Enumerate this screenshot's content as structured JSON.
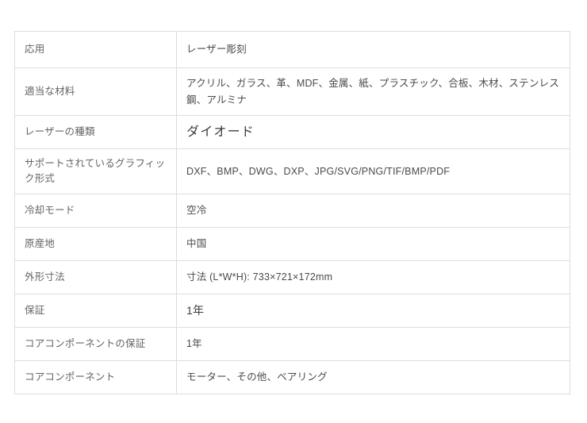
{
  "document": {
    "type": "specification-table",
    "background_color": "#ffffff",
    "border_color": "#dddddd",
    "label_color": "#646464",
    "value_color": "#4a4a4a"
  },
  "table": {
    "rows": [
      {
        "label": "応用",
        "value": "レーザー彫刻",
        "height_class": "h-first",
        "value_size": "normal"
      },
      {
        "label": "適当な材料",
        "value": "アクリル、ガラス、革、MDF、金属、紙、プラスチック、合板、木材、ステンレス鋼、アルミナ",
        "height_class": "h-double",
        "value_size": "normal"
      },
      {
        "label": "レーザーの種類",
        "value": "ダイオード",
        "height_class": "h-single",
        "value_size": "large"
      },
      {
        "label": "サポートされているグラフィック形式",
        "value": "DXF、BMP、DWG、DXP、JPG/SVG/PNG/TIF/BMP/PDF",
        "height_class": "h-tall",
        "value_size": "normal"
      },
      {
        "label": "冷却モード",
        "value": "空冷",
        "height_class": "h-single",
        "value_size": "normal"
      },
      {
        "label": "原産地",
        "value": "中国",
        "height_class": "h-single",
        "value_size": "normal"
      },
      {
        "label": "外形寸法",
        "value": "寸法 (L*W*H): 733×721×172mm",
        "height_class": "h-single",
        "value_size": "normal"
      },
      {
        "label": "保証",
        "value": "1年",
        "height_class": "h-single",
        "value_size": "medium"
      },
      {
        "label": "コアコンポーネントの保証",
        "value": "1年",
        "height_class": "h-single",
        "value_size": "normal"
      },
      {
        "label": "コアコンポーネント",
        "value": "モーター、その他、ベアリング",
        "height_class": "h-single",
        "value_size": "normal"
      }
    ]
  }
}
